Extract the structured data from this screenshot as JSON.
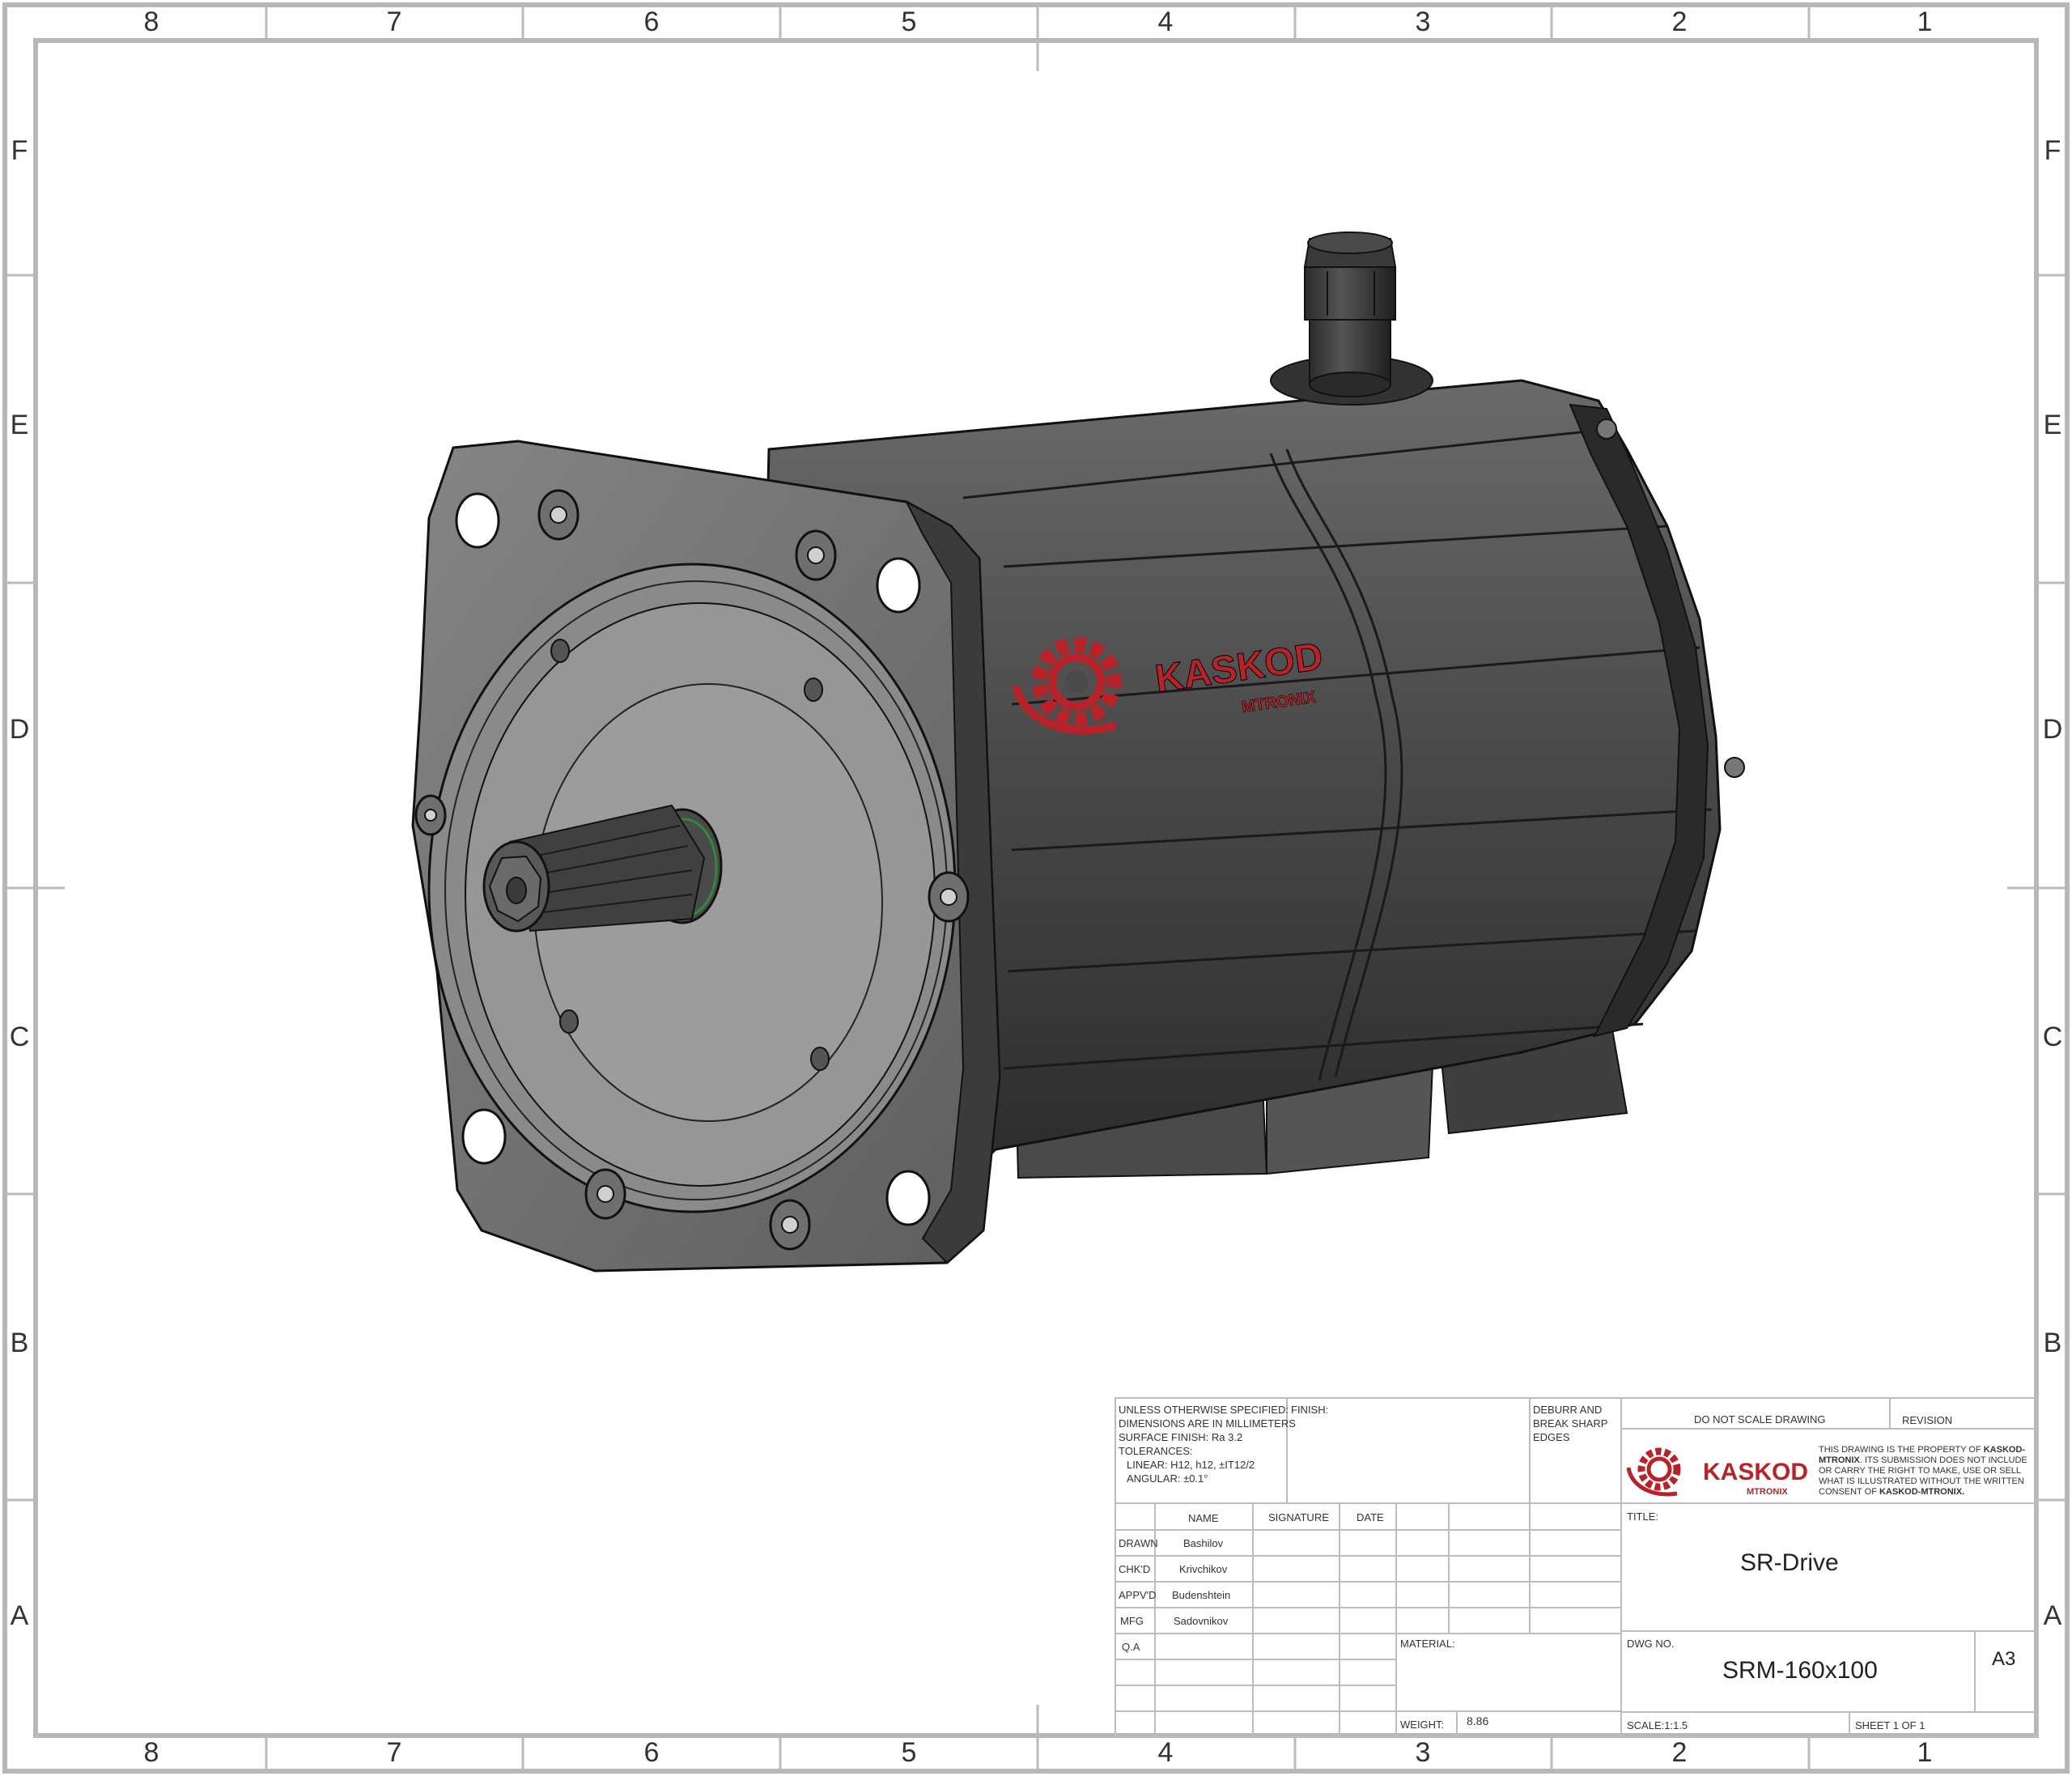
{
  "zones": {
    "columns": [
      "8",
      "7",
      "6",
      "5",
      "4",
      "3",
      "2",
      "1"
    ],
    "rows": [
      "F",
      "E",
      "D",
      "C",
      "B",
      "A"
    ]
  },
  "logo": {
    "name": "KASKOD",
    "sub": "MTRONIX",
    "color": "#b8232a"
  },
  "title_block": {
    "spec_notes": [
      "UNLESS OTHERWISE SPECIFIED:",
      "DIMENSIONS ARE IN MILLIMETERS",
      "SURFACE FINISH: Ra 3.2",
      "TOLERANCES:",
      "   LINEAR: H12, h12, ±IT12/2",
      "   ANGULAR: ±0.1°"
    ],
    "finish_label": "FINISH:",
    "deburr_text": [
      "DEBURR AND",
      "BREAK SHARP",
      "EDGES"
    ],
    "do_not_scale": "DO NOT SCALE DRAWING",
    "revision_label": "REVISION",
    "notice_prefix": "THIS DRAWING IS THE PROPERTY OF ",
    "notice_company1": "KASKOD-MTRONIX",
    "notice_middle": ". ITS SUBMISSION DOES NOT INCLUDE OR CARRY THE RIGHT TO MAKE, USE OR SELL WHAT IS ILLUSTRATED WITHOUT THE WRITTEN CONSENT OF ",
    "notice_company2": "KASKOD-MTRONIX.",
    "headers": {
      "name": "NAME",
      "signature": "SIGNATURE",
      "date": "DATE"
    },
    "people": [
      {
        "role": "DRAWN",
        "name": "Bashilov"
      },
      {
        "role": "CHK'D",
        "name": "Krivchikov"
      },
      {
        "role": "APPV'D",
        "name": "Budenshtein"
      },
      {
        "role": "MFG",
        "name": "Sadovnikov"
      },
      {
        "role": "Q.A",
        "name": ""
      }
    ],
    "material_label": "MATERIAL:",
    "weight_label": "WEIGHT:",
    "weight_value": "8.86",
    "title_label": "TITLE:",
    "title_value": "SR-Drive",
    "dwg_no_label": "DWG NO.",
    "dwg_no_value": "SRM-160x100",
    "sheet_size": "A3",
    "scale": "SCALE:1:1.5",
    "sheet": "SHEET 1 OF 1"
  }
}
